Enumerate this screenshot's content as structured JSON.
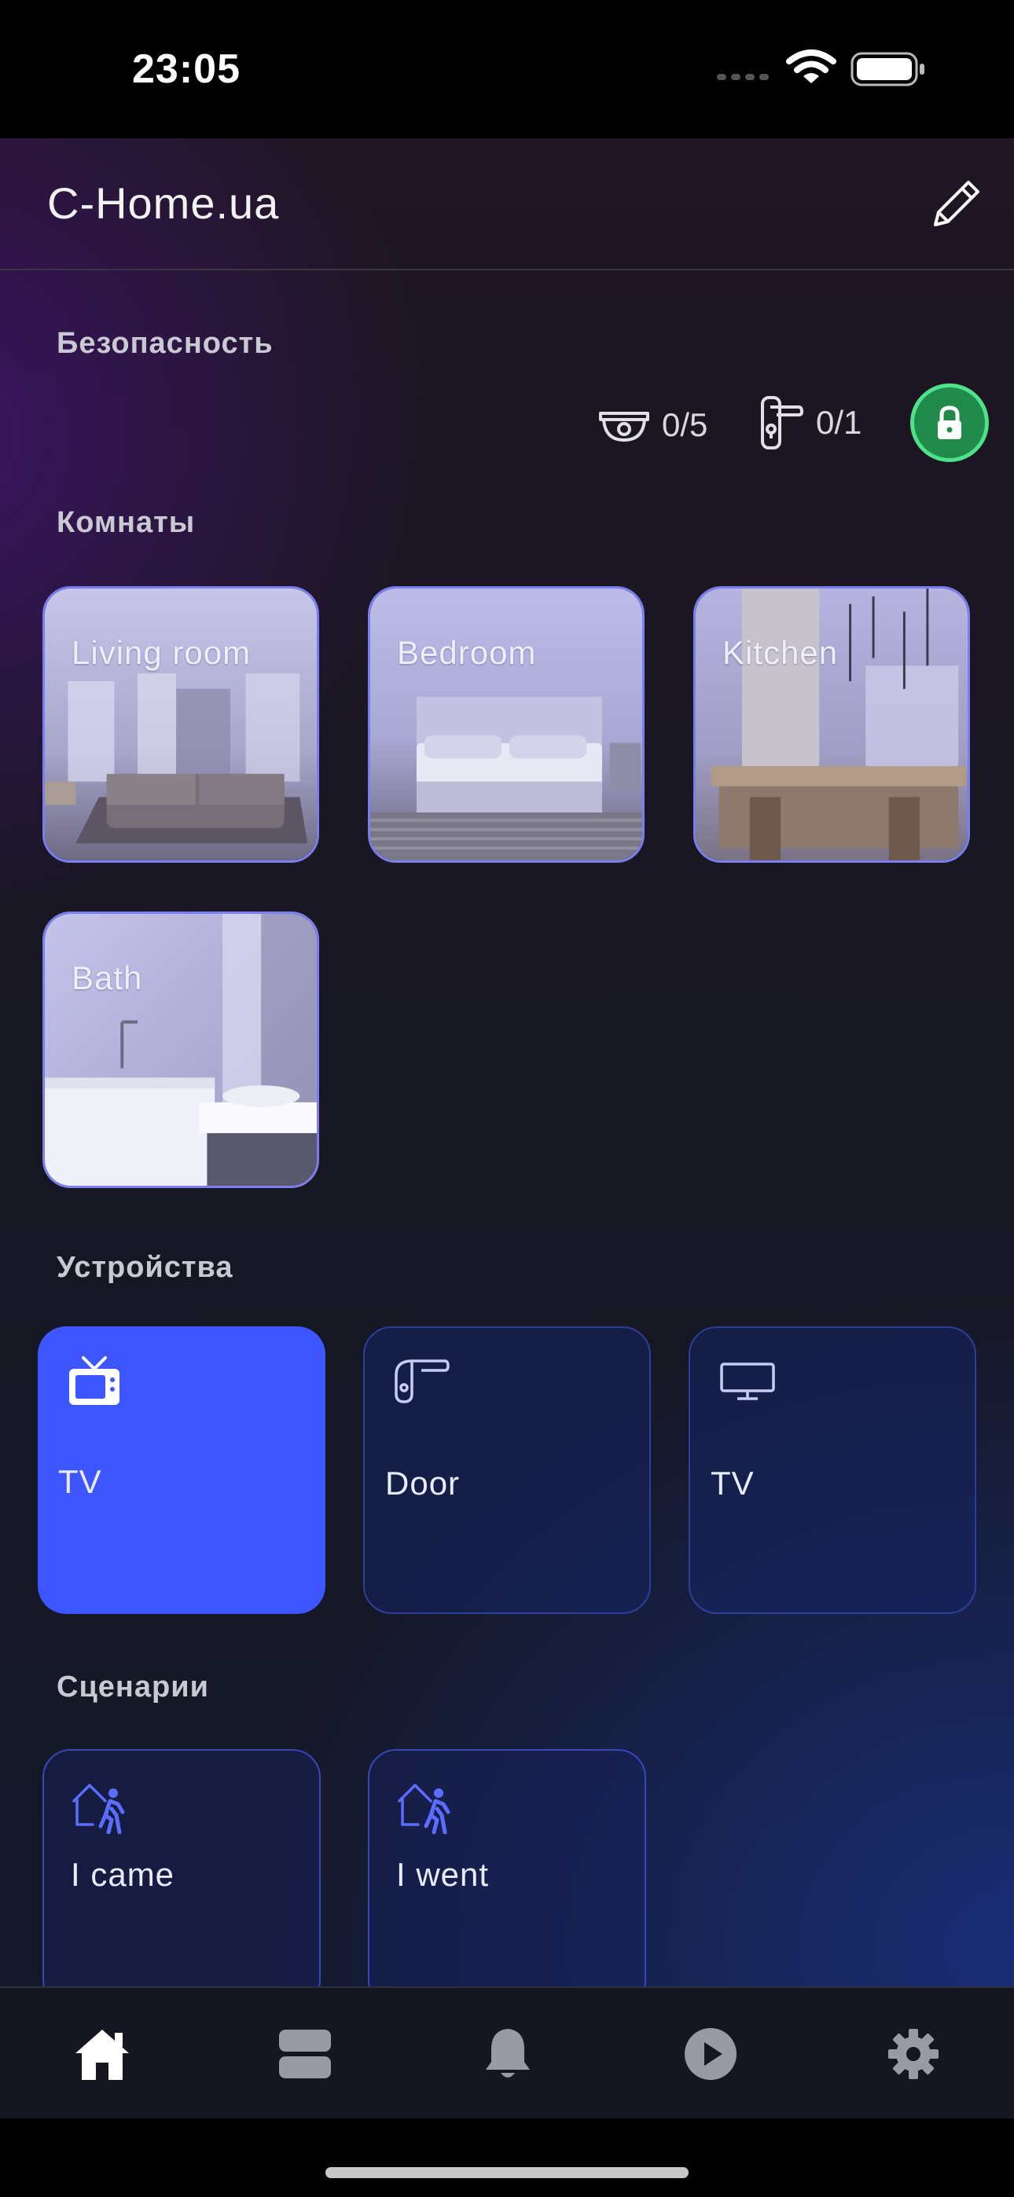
{
  "status_bar": {
    "time": "23:05"
  },
  "header": {
    "title": "C-Home.ua",
    "edit_icon": "pencil-icon"
  },
  "security": {
    "title": "Безопасность",
    "cameras": {
      "icon": "camera-dome-icon",
      "count": "0/5"
    },
    "doors": {
      "icon": "door-handle-icon",
      "count": "0/1"
    },
    "lock": {
      "icon": "lock-icon",
      "color": "#1f8a4a",
      "ring_color": "#4ee38a"
    }
  },
  "rooms": {
    "title": "Комнаты",
    "items": [
      {
        "label": "Living room"
      },
      {
        "label": "Bedroom"
      },
      {
        "label": "Kitchen"
      },
      {
        "label": "Bath"
      }
    ]
  },
  "devices": {
    "title": "Устройства",
    "items": [
      {
        "label": "TV",
        "icon": "tv-icon",
        "active": true
      },
      {
        "label": "Door",
        "icon": "door-handle-icon",
        "active": false
      },
      {
        "label": "TV",
        "icon": "monitor-icon",
        "active": false
      }
    ],
    "active_color": "#3d56ff"
  },
  "scenarios": {
    "title": "Сценарии",
    "items": [
      {
        "label": "I came",
        "icon": "home-walking-icon"
      },
      {
        "label": "I went",
        "icon": "home-walking-icon"
      }
    ]
  },
  "tabbar": {
    "items": [
      {
        "icon": "home-icon",
        "active": true
      },
      {
        "icon": "server-icon",
        "active": false
      },
      {
        "icon": "bell-icon",
        "active": false
      },
      {
        "icon": "play-icon",
        "active": false
      },
      {
        "icon": "gear-icon",
        "active": false
      }
    ]
  }
}
